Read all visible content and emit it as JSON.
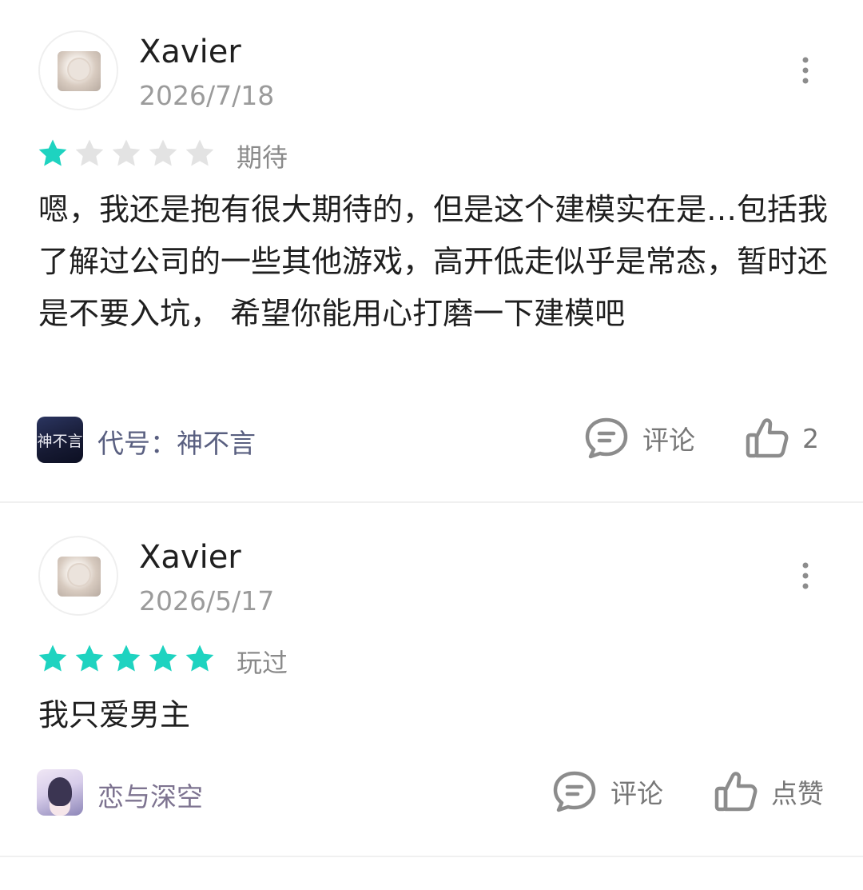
{
  "reviews": [
    {
      "username": "Xavier",
      "date": "2026/7/18",
      "rating": 1,
      "rating_max": 5,
      "rating_tag": "期待",
      "content": "嗯，我还是抱有很大期待的，但是这个建模实在是…包括我了解过公司的一些其他游戏，高开低走似乎是常态，暂时还是不要入坑， 希望你能用心打磨一下建模吧",
      "game": {
        "name": "代号：神不言",
        "icon_text": "神不言",
        "icon": "game-icon-dark"
      },
      "comment_label": "评论",
      "like_label": "2"
    },
    {
      "username": "Xavier",
      "date": "2026/5/17",
      "rating": 5,
      "rating_max": 5,
      "rating_tag": "玩过",
      "content": "我只爱男主",
      "game": {
        "name": "恋与深空",
        "icon": "game-icon-pink"
      },
      "comment_label": "评论",
      "like_label": "点赞"
    }
  ],
  "icons": {
    "more": "more-vertical-icon",
    "comment": "comment-bubble-icon",
    "like": "thumbs-up-icon",
    "star": "star-icon"
  },
  "colors": {
    "star_filled": "#1ed3c0",
    "star_empty": "#e3e3e3",
    "icon_stroke": "#8c8c8c"
  }
}
